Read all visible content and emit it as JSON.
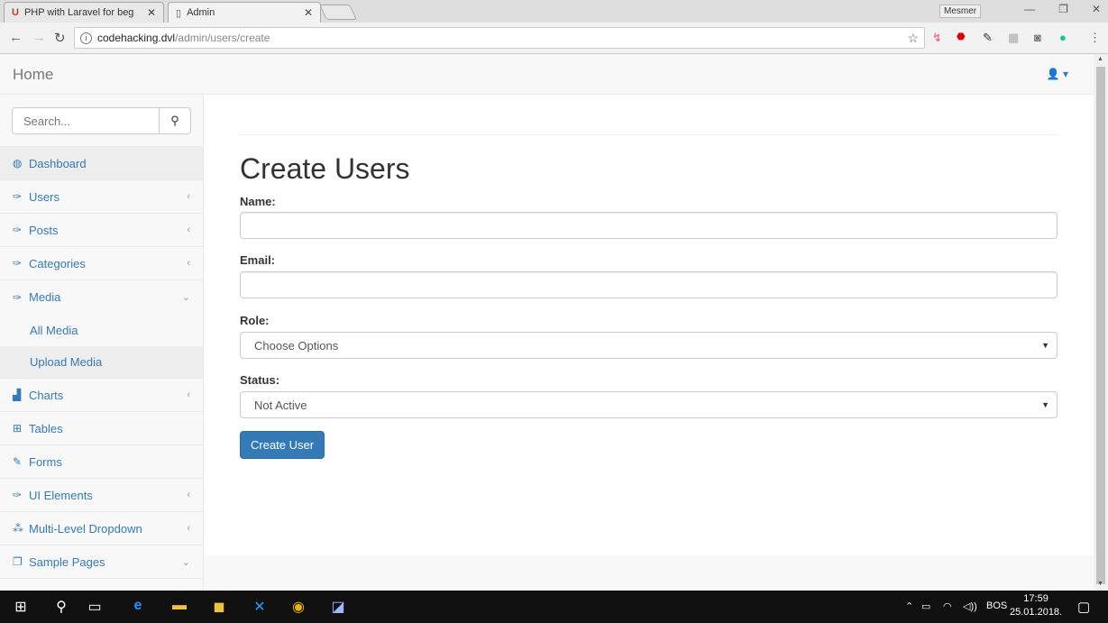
{
  "browser": {
    "tabs": [
      {
        "title": "PHP with Laravel for beg",
        "icon": "udemy-icon"
      },
      {
        "title": "Admin",
        "icon": "page-icon"
      }
    ],
    "profile_name": "Mesmer",
    "url_host": "codehacking.dvl",
    "url_path": "/admin/users/create"
  },
  "navbar": {
    "brand": "Home",
    "user_icon": "user-icon"
  },
  "sidebar": {
    "search_placeholder": "Search...",
    "items": [
      {
        "label": "Dashboard",
        "icon": "dashboard-icon"
      },
      {
        "label": "Users",
        "icon": "wrench-icon"
      },
      {
        "label": "Posts",
        "icon": "wrench-icon"
      },
      {
        "label": "Categories",
        "icon": "wrench-icon"
      },
      {
        "label": "Media",
        "icon": "wrench-icon"
      },
      {
        "label": "All Media"
      },
      {
        "label": "Upload Media"
      },
      {
        "label": "Charts",
        "icon": "bar-chart-icon"
      },
      {
        "label": "Tables",
        "icon": "table-icon"
      },
      {
        "label": "Forms",
        "icon": "edit-icon"
      },
      {
        "label": "UI Elements",
        "icon": "wrench-icon"
      },
      {
        "label": "Multi-Level Dropdown",
        "icon": "sitemap-icon"
      },
      {
        "label": "Sample Pages",
        "icon": "files-icon"
      }
    ]
  },
  "form": {
    "title": "Create Users",
    "name_label": "Name:",
    "name_value": "",
    "email_label": "Email:",
    "email_value": "",
    "role_label": "Role:",
    "role_selected": "Choose Options",
    "status_label": "Status:",
    "status_selected": "Not Active",
    "submit_label": "Create User"
  },
  "taskbar": {
    "language": "BOS",
    "time": "17:59",
    "date": "25.01.2018."
  },
  "colors": {
    "link": "#337ab7",
    "primary_button": "#337ab7",
    "sidebar_bg": "#f8f8f8"
  }
}
